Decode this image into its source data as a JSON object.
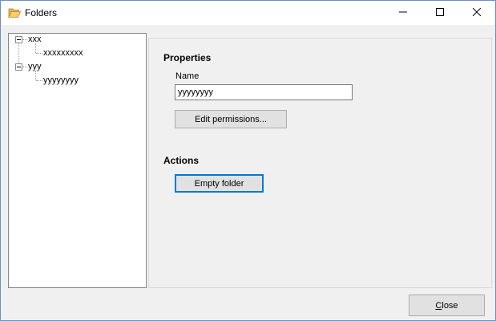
{
  "window": {
    "title": "Folders",
    "icons": {
      "app": "folder-open-icon",
      "minimize": "minimize-icon",
      "maximize": "maximize-icon",
      "close": "close-icon"
    }
  },
  "tree": {
    "nodes": [
      {
        "label": "xxx",
        "children": [
          {
            "label": "xxxxxxxxx"
          }
        ]
      },
      {
        "label": "yyy",
        "children": [
          {
            "label": "yyyyyyyy"
          }
        ]
      }
    ]
  },
  "properties": {
    "heading": "Properties",
    "name_label": "Name",
    "name_value": "yyyyyyyy",
    "edit_permissions_label": "Edit permissions..."
  },
  "actions": {
    "heading": "Actions",
    "empty_folder_label": "Empty folder"
  },
  "footer": {
    "close_first_letter": "C",
    "close_rest": "lose"
  },
  "colors": {
    "accent": "#0078d7",
    "window_bg": "#f0f0f0"
  }
}
